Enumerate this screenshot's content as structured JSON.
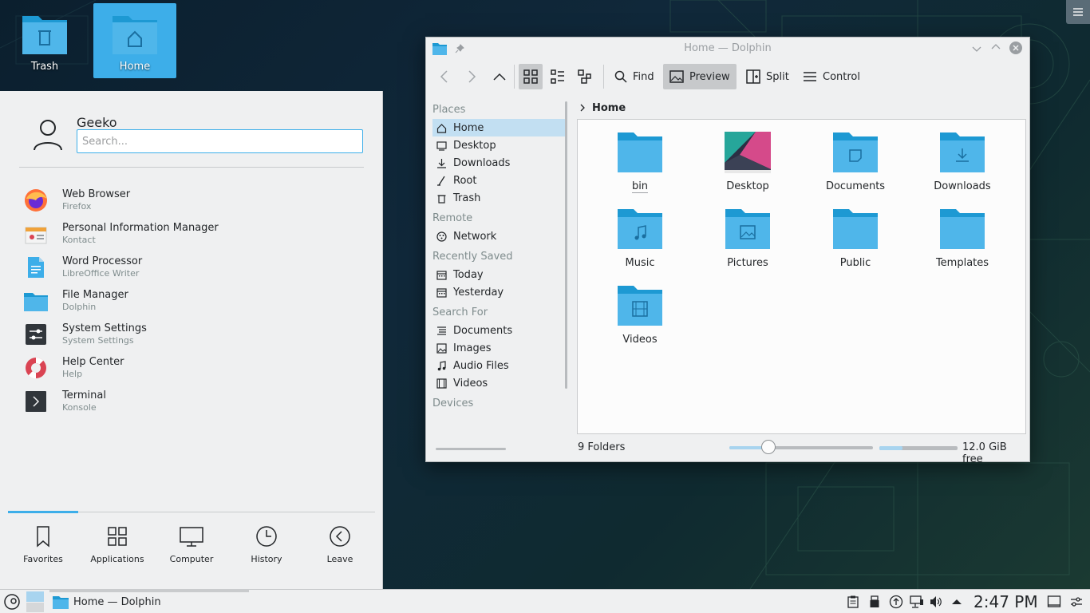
{
  "desktop": {
    "icons": [
      {
        "label": "Trash"
      },
      {
        "label": "Home"
      }
    ]
  },
  "launcher": {
    "user_name": "Geeko",
    "search_placeholder": "Search...",
    "apps": [
      {
        "title": "Web Browser",
        "subtitle": "Firefox",
        "icon": "firefox-icon"
      },
      {
        "title": "Personal Information Manager",
        "subtitle": "Kontact",
        "icon": "kontact-icon"
      },
      {
        "title": "Word Processor",
        "subtitle": "LibreOffice Writer",
        "icon": "writer-icon"
      },
      {
        "title": "File Manager",
        "subtitle": "Dolphin",
        "icon": "folder-icon"
      },
      {
        "title": "System Settings",
        "subtitle": "System Settings",
        "icon": "settings-icon"
      },
      {
        "title": "Help Center",
        "subtitle": "Help",
        "icon": "lifebuoy-icon"
      },
      {
        "title": "Terminal",
        "subtitle": "Konsole",
        "icon": "terminal-icon"
      }
    ],
    "tabs": [
      {
        "label": "Favorites"
      },
      {
        "label": "Applications"
      },
      {
        "label": "Computer"
      },
      {
        "label": "History"
      },
      {
        "label": "Leave"
      }
    ],
    "active_tab": "Favorites"
  },
  "taskbar": {
    "task_label": "Home — Dolphin",
    "clock": "2:47 PM"
  },
  "dolphin": {
    "title": "Home — Dolphin",
    "toolbar": {
      "find": "Find",
      "preview": "Preview",
      "split": "Split",
      "control": "Control"
    },
    "places": {
      "sections": [
        {
          "header": "Places",
          "items": [
            {
              "label": "Home",
              "icon": "home-icon",
              "selected": true
            },
            {
              "label": "Desktop",
              "icon": "desktop-icon"
            },
            {
              "label": "Downloads",
              "icon": "download-icon"
            },
            {
              "label": "Root",
              "icon": "root-icon"
            },
            {
              "label": "Trash",
              "icon": "trash-icon"
            }
          ]
        },
        {
          "header": "Remote",
          "items": [
            {
              "label": "Network",
              "icon": "network-icon"
            }
          ]
        },
        {
          "header": "Recently Saved",
          "items": [
            {
              "label": "Today",
              "icon": "calendar-icon"
            },
            {
              "label": "Yesterday",
              "icon": "calendar-icon"
            }
          ]
        },
        {
          "header": "Search For",
          "items": [
            {
              "label": "Documents",
              "icon": "document-icon"
            },
            {
              "label": "Images",
              "icon": "image-icon"
            },
            {
              "label": "Audio Files",
              "icon": "music-icon"
            },
            {
              "label": "Videos",
              "icon": "video-icon"
            }
          ]
        },
        {
          "header": "Devices",
          "items": []
        }
      ]
    },
    "breadcrumb": "Home",
    "folders": [
      {
        "name": "bin",
        "emblem": "none"
      },
      {
        "name": "Desktop",
        "emblem": "preview"
      },
      {
        "name": "Documents",
        "emblem": "document"
      },
      {
        "name": "Downloads",
        "emblem": "download"
      },
      {
        "name": "Music",
        "emblem": "music"
      },
      {
        "name": "Pictures",
        "emblem": "picture"
      },
      {
        "name": "Public",
        "emblem": "none"
      },
      {
        "name": "Templates",
        "emblem": "none"
      },
      {
        "name": "Videos",
        "emblem": "video"
      }
    ],
    "status": {
      "summary": "9 Folders",
      "zoom_level": 0.27,
      "disk_used_fraction": 0.3,
      "free_space": "12.0 GiB free"
    }
  },
  "colors": {
    "accent": "#3daee9",
    "folder": "#4fb6ea",
    "folder_dark": "#1d99d3",
    "panel": "#eff0f1"
  }
}
